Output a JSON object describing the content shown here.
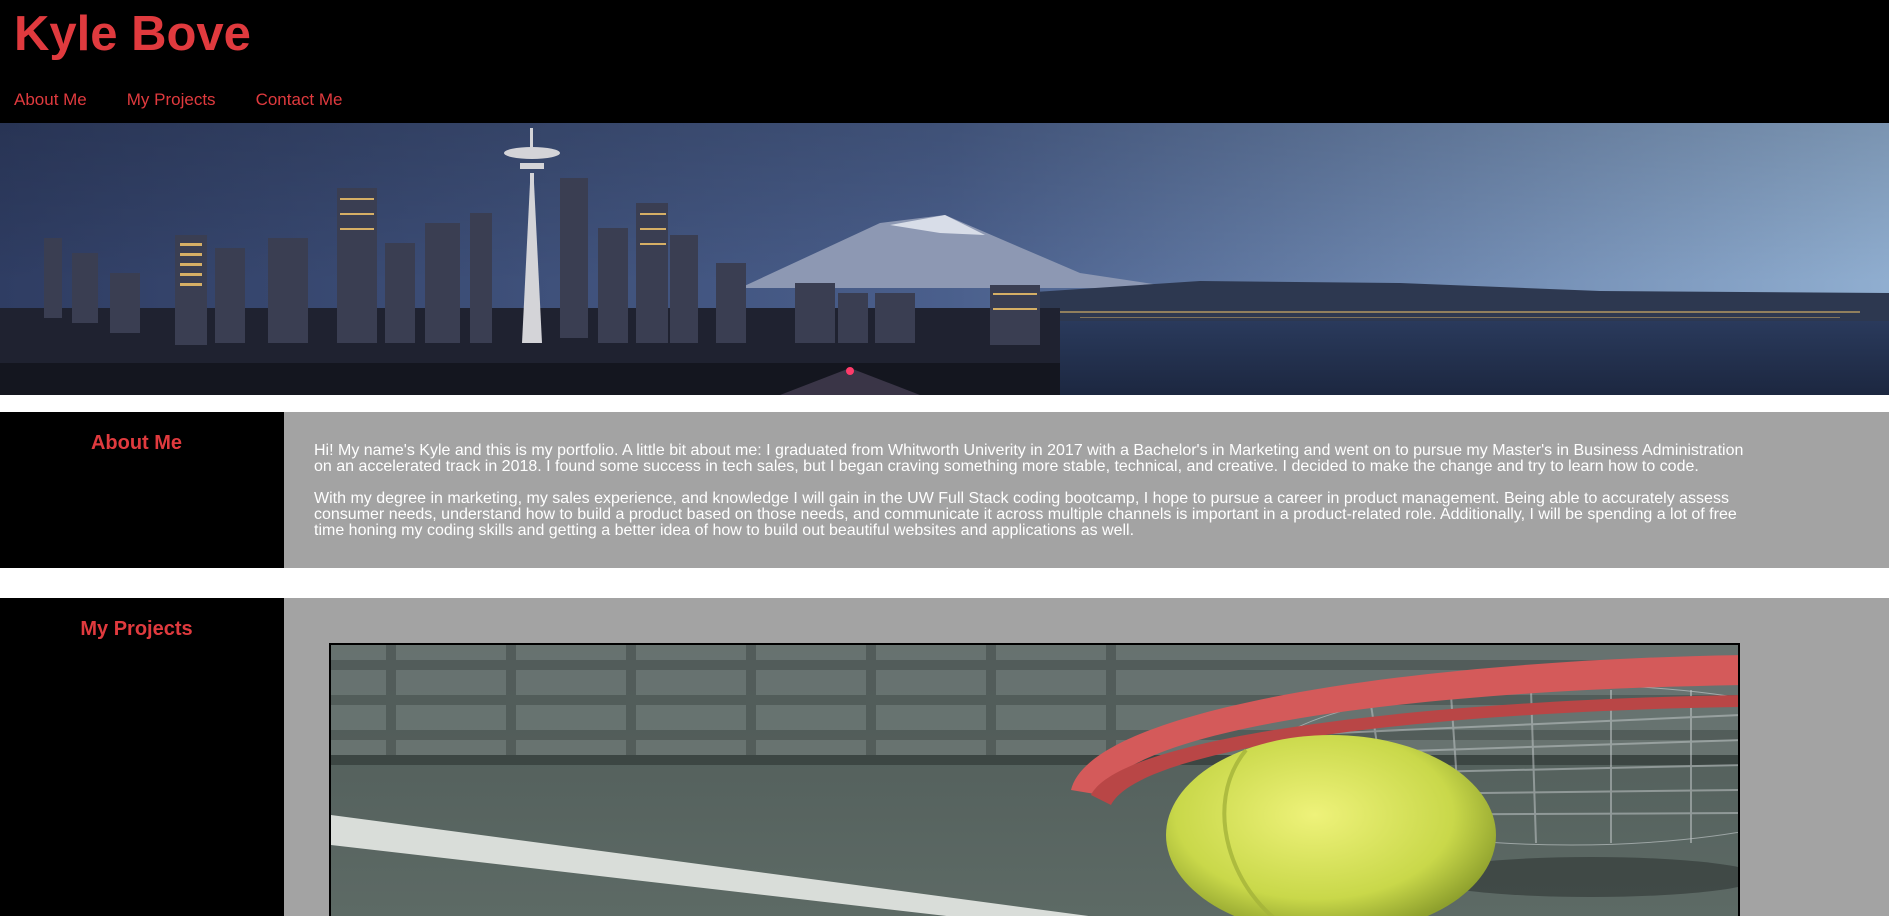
{
  "header": {
    "title": "Kyle Bove",
    "nav": [
      "About Me",
      "My Projects",
      "Contact Me"
    ]
  },
  "hero": {
    "image": "seattle-skyline-banner"
  },
  "about": {
    "heading": "About Me",
    "paragraphs": [
      "Hi! My name's Kyle and this is my portfolio. A little bit about me: I graduated from Whitworth Univerity in 2017 with a Bachelor's in Marketing and went on to pursue my Master's in Business Administration on an accelerated track in 2018. I found some success in tech sales, but I began craving something more stable, technical, and creative. I decided to make the change and try to learn how to code.",
      "With my degree in marketing, my sales experience, and knowledge I will gain in the UW Full Stack coding bootcamp, I hope to pursue a career in product management. Being able to accurately assess consumer needs, understand how to build a product based on those needs, and communicate it across multiple channels is important in a product-related role. Additionally, I will be spending a lot of free time honing my coding skills and getting a better idea of how to build out beautiful websites and applications as well."
    ]
  },
  "projects": {
    "heading": "My Projects",
    "items": [
      {
        "image": "tennis-ball-racket-photo"
      }
    ]
  },
  "colors": {
    "accent": "#e03a3e",
    "header_bg": "#000000",
    "panel_bg": "#a3a3a3",
    "text_light": "#ffffff"
  }
}
